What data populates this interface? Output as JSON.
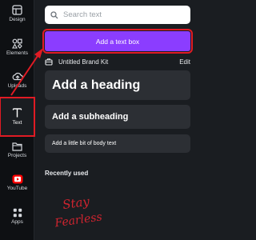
{
  "rail": {
    "items": [
      {
        "label": "Design",
        "icon": "design-icon"
      },
      {
        "label": "Elements",
        "icon": "elements-icon"
      },
      {
        "label": "Uploads",
        "icon": "upload-icon"
      },
      {
        "label": "Text",
        "icon": "text-icon",
        "active": true
      },
      {
        "label": "Projects",
        "icon": "folder-icon"
      },
      {
        "label": "YouTube",
        "icon": "youtube-icon"
      },
      {
        "label": "Apps",
        "icon": "apps-icon"
      }
    ]
  },
  "search": {
    "placeholder": "Search text",
    "value": ""
  },
  "add_text_box": {
    "label": "Add a text box"
  },
  "brand_kit": {
    "name": "Untitled Brand Kit",
    "edit_label": "Edit"
  },
  "text_styles": {
    "heading": "Add a heading",
    "subheading": "Add a subheading",
    "body": "Add a little bit of body text"
  },
  "recently_used": {
    "title": "Recently used",
    "items": [
      {
        "line1": "Stay",
        "line2": "Fearless"
      }
    ]
  },
  "colors": {
    "accent": "#8b3dff",
    "highlight": "#e01b24",
    "panel_bg": "#1a1d21",
    "rail_bg": "#0e1013",
    "card_bg": "#2c2f34"
  }
}
